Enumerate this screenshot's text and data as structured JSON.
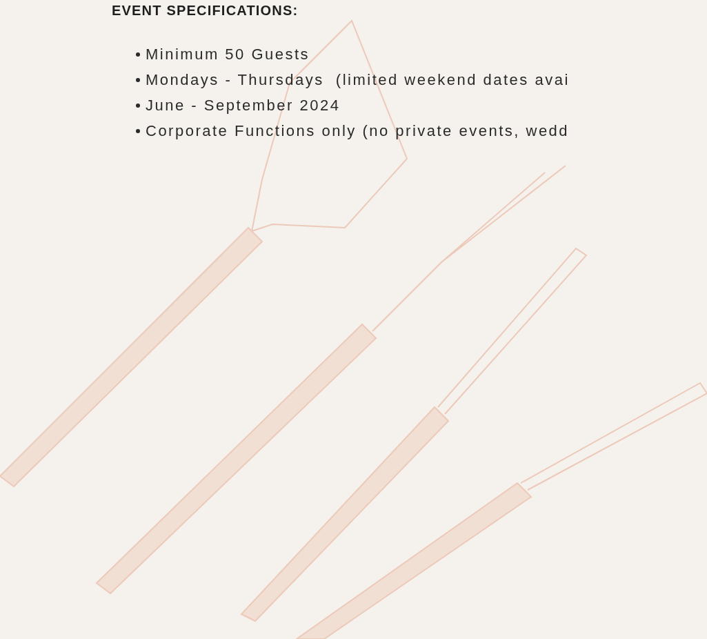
{
  "heading": "EVENT SPECIFICATIONS:",
  "items": [
    "Minimum 50 Guests",
    "Mondays - Thursdays  (limited weekend dates avai",
    "June - September 2024",
    "Corporate Functions only (no private events, wedd"
  ]
}
